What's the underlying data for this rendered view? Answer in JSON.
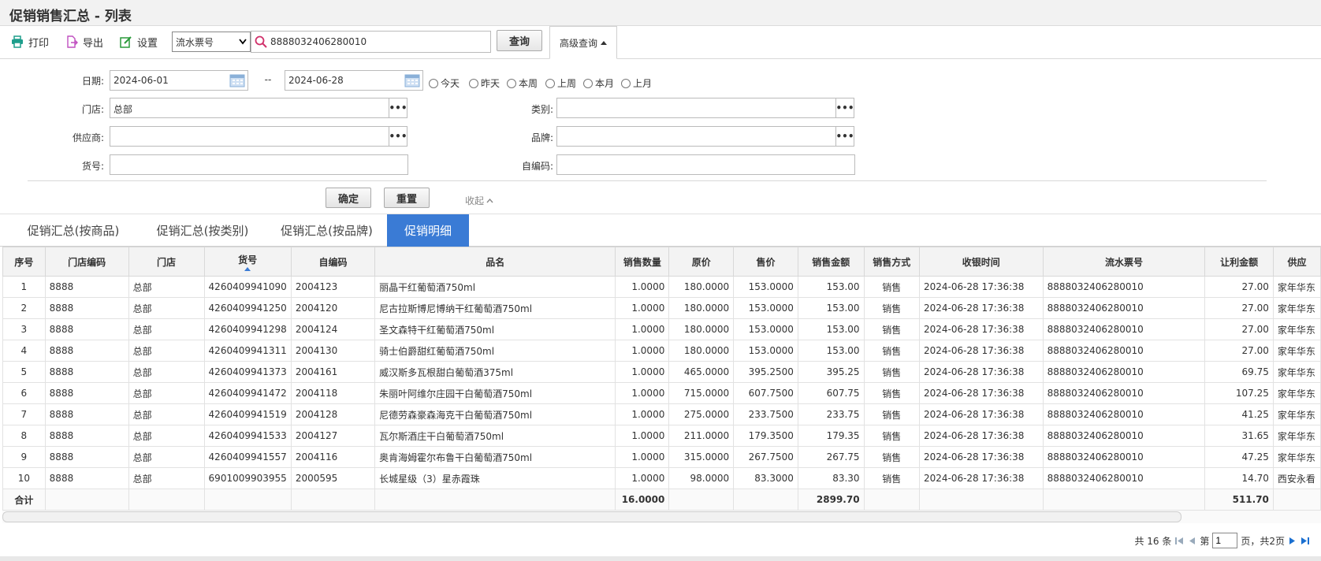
{
  "page": {
    "title": "促销销售汇总 - 列表"
  },
  "toolbar": {
    "print": "打印",
    "export": "导出",
    "settings": "设置",
    "search_type": "流水票号",
    "search_value": "8888032406280010",
    "query": "查询",
    "advanced": "高级查询"
  },
  "filters": {
    "date_label": "日期:",
    "date_from": "2024-06-01",
    "date_sep": "--",
    "date_to": "2024-06-28",
    "quick": [
      "今天",
      "昨天",
      "本周",
      "上周",
      "本月",
      "上月"
    ],
    "store_label": "门店:",
    "store_value": "总部",
    "category_label": "类别:",
    "category_value": "",
    "supplier_label": "供应商:",
    "supplier_value": "",
    "brand_label": "品牌:",
    "brand_value": "",
    "sku_label": "货号:",
    "sku_value": "",
    "selfcode_label": "自编码:",
    "selfcode_value": "",
    "confirm": "确定",
    "reset": "重置",
    "collapse": "收起"
  },
  "tabs": [
    "促销汇总(按商品)",
    "促销汇总(按类别)",
    "促销汇总(按品牌)",
    "促销明细"
  ],
  "active_tab": 3,
  "accent_color": "#3a7bd5",
  "table": {
    "columns": [
      "序号",
      "门店编码",
      "门店",
      "货号",
      "自编码",
      "品名",
      "销售数量",
      "原价",
      "售价",
      "销售金额",
      "销售方式",
      "收银时间",
      "流水票号",
      "让利金额",
      "供应"
    ],
    "sorted_column": "货号",
    "rows": [
      [
        "1",
        "8888",
        "总部",
        "4260409941090",
        "2004123",
        "丽晶干红葡萄酒750ml",
        "1.0000",
        "180.0000",
        "153.0000",
        "153.00",
        "销售",
        "2024-06-28 17:36:38",
        "8888032406280010",
        "27.00",
        "家年华东"
      ],
      [
        "2",
        "8888",
        "总部",
        "4260409941250",
        "2004120",
        "尼古拉斯博尼博纳干红葡萄酒750ml",
        "1.0000",
        "180.0000",
        "153.0000",
        "153.00",
        "销售",
        "2024-06-28 17:36:38",
        "8888032406280010",
        "27.00",
        "家年华东"
      ],
      [
        "3",
        "8888",
        "总部",
        "4260409941298",
        "2004124",
        "圣文森特干红葡萄酒750ml",
        "1.0000",
        "180.0000",
        "153.0000",
        "153.00",
        "销售",
        "2024-06-28 17:36:38",
        "8888032406280010",
        "27.00",
        "家年华东"
      ],
      [
        "4",
        "8888",
        "总部",
        "4260409941311",
        "2004130",
        "骑士伯爵甜红葡萄酒750ml",
        "1.0000",
        "180.0000",
        "153.0000",
        "153.00",
        "销售",
        "2024-06-28 17:36:38",
        "8888032406280010",
        "27.00",
        "家年华东"
      ],
      [
        "5",
        "8888",
        "总部",
        "4260409941373",
        "2004161",
        "威汉斯多瓦根甜白葡萄酒375ml",
        "1.0000",
        "465.0000",
        "395.2500",
        "395.25",
        "销售",
        "2024-06-28 17:36:38",
        "8888032406280010",
        "69.75",
        "家年华东"
      ],
      [
        "6",
        "8888",
        "总部",
        "4260409941472",
        "2004118",
        "朱丽叶阿维尔庄园干白葡萄酒750ml",
        "1.0000",
        "715.0000",
        "607.7500",
        "607.75",
        "销售",
        "2024-06-28 17:36:38",
        "8888032406280010",
        "107.25",
        "家年华东"
      ],
      [
        "7",
        "8888",
        "总部",
        "4260409941519",
        "2004128",
        "尼德劳森豪森海克干白葡萄酒750ml",
        "1.0000",
        "275.0000",
        "233.7500",
        "233.75",
        "销售",
        "2024-06-28 17:36:38",
        "8888032406280010",
        "41.25",
        "家年华东"
      ],
      [
        "8",
        "8888",
        "总部",
        "4260409941533",
        "2004127",
        "瓦尔斯酒庄干白葡萄酒750ml",
        "1.0000",
        "211.0000",
        "179.3500",
        "179.35",
        "销售",
        "2024-06-28 17:36:38",
        "8888032406280010",
        "31.65",
        "家年华东"
      ],
      [
        "9",
        "8888",
        "总部",
        "4260409941557",
        "2004116",
        "奥肯海姆霍尔布鲁干白葡萄酒750ml",
        "1.0000",
        "315.0000",
        "267.7500",
        "267.75",
        "销售",
        "2024-06-28 17:36:38",
        "8888032406280010",
        "47.25",
        "家年华东"
      ],
      [
        "10",
        "8888",
        "总部",
        "6901009903955",
        "2000595",
        "长城星级（3）星赤霞珠",
        "1.0000",
        "98.0000",
        "83.3000",
        "83.30",
        "销售",
        "2024-06-28 17:36:38",
        "8888032406280010",
        "14.70",
        "西安永看"
      ]
    ],
    "total_label": "合计",
    "total_qty": "16.0000",
    "total_amount": "2899.70",
    "total_discount": "511.70"
  },
  "pager": {
    "total_text": "共 16 条",
    "page_prefix": "第",
    "page_value": "1",
    "page_suffix": "页，共2页"
  }
}
